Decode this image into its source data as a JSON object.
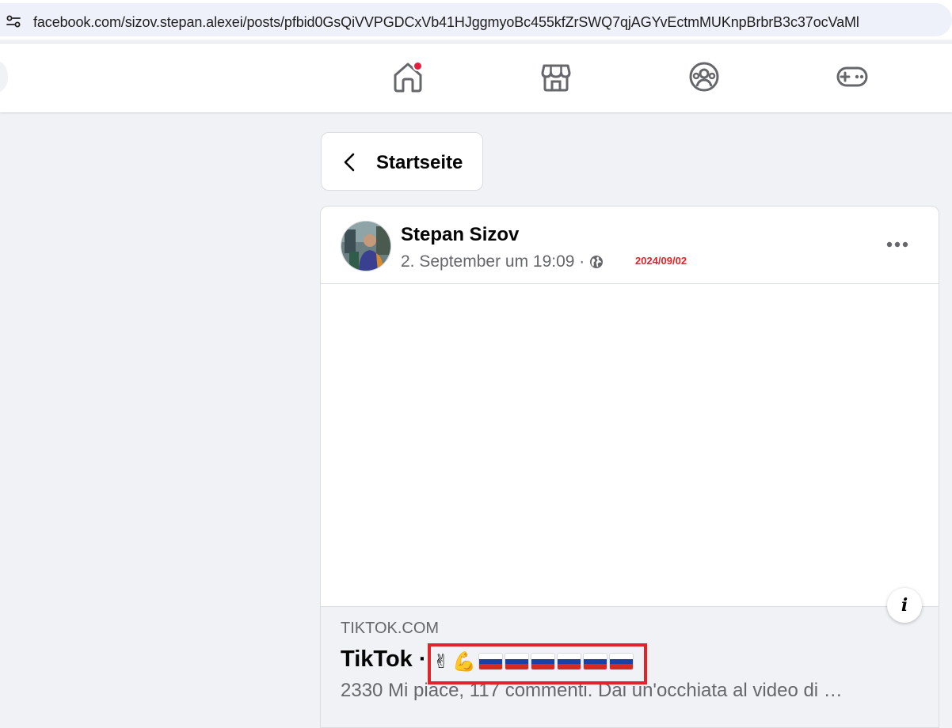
{
  "browser": {
    "url": "facebook.com/sizov.stepan.alexei/posts/pfbid0GsQiVVPGDCxVb41HJggmyoBc455kfZrSWQ7qjAGYvEctmMUKnpBrbrB3c37ocVaMl"
  },
  "topnav": {
    "icons": [
      "home-icon",
      "marketplace-icon",
      "groups-icon",
      "gaming-icon"
    ],
    "notification_color": "#e41e3f"
  },
  "back": {
    "label": "Startseite"
  },
  "post": {
    "author": "Stepan Sizov",
    "timestamp": "2. September um 19:09 ·",
    "annotation_date": "2024/09/02",
    "annotation_color": "#e0242a",
    "link": {
      "domain": "TIKTOK.COM",
      "title": "TikTok ·",
      "title_emojis": [
        "✌",
        "💪",
        "flag-ru",
        "flag-ru",
        "flag-ru",
        "flag-ru",
        "flag-ru",
        "flag-ru"
      ],
      "description": "2330 Mi piace, 117 commenti. Dai un'occhiata al video di …"
    }
  }
}
